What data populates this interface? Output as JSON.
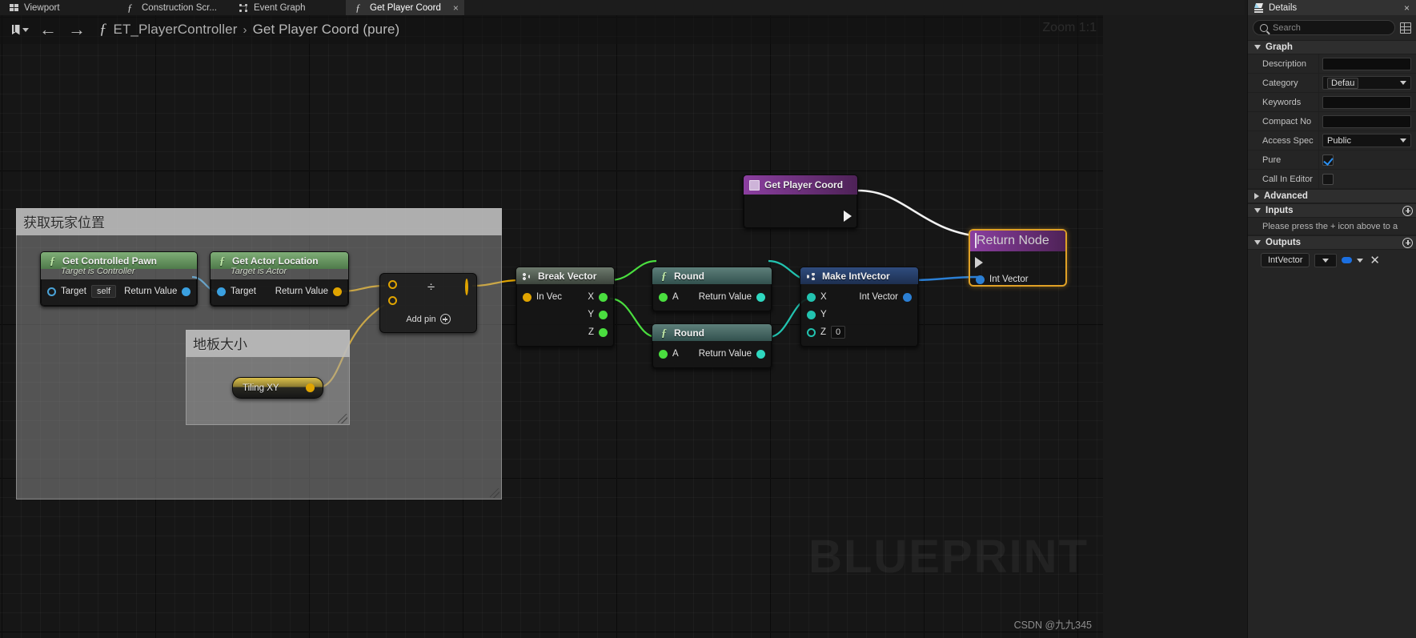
{
  "tabs": [
    {
      "label": "Viewport",
      "icon": "viewport-icon",
      "active": false,
      "closable": false
    },
    {
      "label": "Construction Scr...",
      "icon": "function-icon",
      "active": false,
      "closable": false
    },
    {
      "label": "Event Graph",
      "icon": "graph-icon",
      "active": false,
      "closable": false
    },
    {
      "label": "Get Player Coord",
      "icon": "function-icon",
      "active": true,
      "closable": true
    }
  ],
  "toolbar": {
    "back_label": "←",
    "forward_label": "→",
    "breadcrumb_root": "ET_PlayerController",
    "breadcrumb_sep": "›",
    "breadcrumb_leaf": "Get Player Coord (pure)",
    "zoom_label": "Zoom 1:1"
  },
  "graph": {
    "watermark": "BLUEPRINT",
    "credit": "CSDN @九九345",
    "comments": [
      {
        "title": "获取玩家位置"
      },
      {
        "title": "地板大小"
      }
    ],
    "nodes": {
      "get_controlled_pawn": {
        "title": "Get Controlled Pawn",
        "subtitle": "Target is Controller",
        "in_pin": "Target",
        "self_value": "self",
        "out_pin": "Return Value"
      },
      "get_actor_location": {
        "title": "Get Actor Location",
        "subtitle": "Target is Actor",
        "in_pin": "Target",
        "out_pin": "Return Value"
      },
      "divide": {
        "glyph": "÷",
        "add_pin": "Add pin"
      },
      "tiling_xy": {
        "title": "Tiling XY"
      },
      "break_vector": {
        "title": "Break Vector",
        "in_pin": "In Vec",
        "out_x": "X",
        "out_y": "Y",
        "out_z": "Z"
      },
      "round_top": {
        "title": "Round",
        "in_pin": "A",
        "out_pin": "Return Value"
      },
      "round_bottom": {
        "title": "Round",
        "in_pin": "A",
        "out_pin": "Return Value"
      },
      "make_intvector": {
        "title": "Make IntVector",
        "in_x": "X",
        "in_y": "Y",
        "in_z": "Z",
        "z_value": "0",
        "out_pin": "Int Vector"
      },
      "get_player_coord": {
        "title": "Get Player Coord"
      },
      "return_node": {
        "title": "Return Node",
        "out_pin": "Int Vector"
      }
    }
  },
  "details": {
    "tab_label": "Details",
    "close_label": "×",
    "search_placeholder": "Search",
    "sections": {
      "graph": {
        "title": "Graph",
        "rows": [
          {
            "name": "Description",
            "type": "text",
            "value": ""
          },
          {
            "name": "Category",
            "type": "combo",
            "value": "Defau"
          },
          {
            "name": "Keywords",
            "type": "text",
            "value": ""
          },
          {
            "name": "Compact No",
            "type": "text",
            "value": ""
          },
          {
            "name": "Access Spec",
            "type": "combo-plain",
            "value": "Public"
          },
          {
            "name": "Pure",
            "type": "checkbox",
            "checked": true
          },
          {
            "name": "Call In Editor",
            "type": "checkbox",
            "checked": false
          }
        ]
      },
      "advanced": {
        "title": "Advanced"
      },
      "inputs": {
        "title": "Inputs",
        "hint": "Please press the + icon above to a"
      },
      "outputs": {
        "title": "Outputs",
        "entry_type": "IntVector",
        "remove_label": "✕"
      }
    }
  },
  "colors": {
    "exec_white": "#f0f0f0",
    "object_blue": "#3aa0e0",
    "struct_blue": "#2b7fd4",
    "float_green": "#4ade3f",
    "int_teal": "#22c3b0",
    "vector_yellow": "#e0a400",
    "selection_orange": "#e0a126"
  }
}
